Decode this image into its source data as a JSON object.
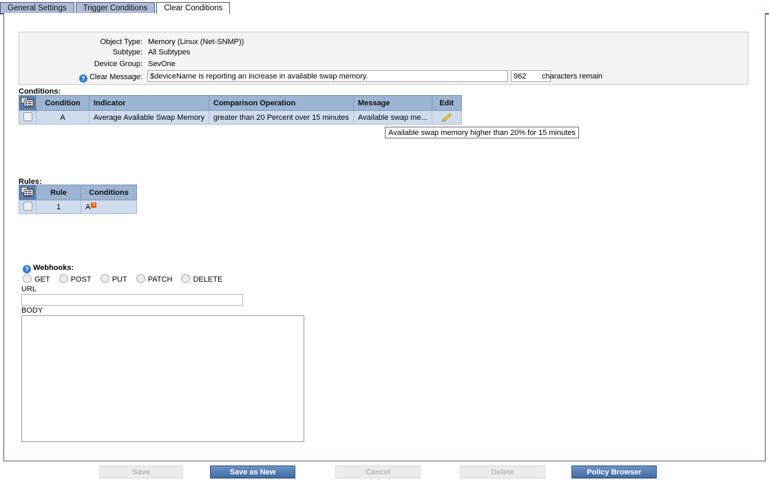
{
  "tabs": [
    {
      "label": "General Settings",
      "active": false
    },
    {
      "label": "Trigger Conditions",
      "active": false
    },
    {
      "label": "Clear Conditions",
      "active": true
    }
  ],
  "info": {
    "object_type_label": "Object Type:",
    "object_type_value": "Memory (Linux (Net-SNMP))",
    "subtype_label": "Subtype:",
    "subtype_value": "All Subtypes",
    "device_group_label": "Device Group:",
    "device_group_value": "SevOne",
    "clear_message_label": "Clear Message:",
    "clear_message_value": "$deviceName is reporting an increase in available swap memory.",
    "characters_remain_value": "962",
    "characters_remain_label": "characters remain",
    "help_icon": "help-icon"
  },
  "conditions": {
    "section_label": "Conditions:",
    "columns": [
      "",
      "Condition",
      "Indicator",
      "Comparison Operation",
      "Message",
      "Edit"
    ],
    "select_all_icon": "select-all-list-icon",
    "rows": [
      {
        "condition": "A",
        "indicator": "Average Available Swap Memory",
        "comparison": "greater than 20 Percent over 15 minutes",
        "message": "Available swap me...",
        "edit_icon": "pencil-icon"
      }
    ],
    "tooltip": "Available swap memory higher than 20% for 15 minutes"
  },
  "rules": {
    "section_label": "Rules:",
    "columns": [
      "",
      "Rule",
      "Conditions"
    ],
    "select_all_icon": "select-all-list-icon",
    "rows": [
      {
        "rule": "1",
        "conditions": "A",
        "remove_badge": "×"
      }
    ]
  },
  "webhooks": {
    "title": "Webhooks:",
    "help_icon": "help-icon",
    "methods": [
      "GET",
      "POST",
      "PUT",
      "PATCH",
      "DELETE"
    ],
    "url_label": "URL",
    "url_value": "",
    "url_placeholder": "",
    "body_label": "BODY",
    "body_value": "",
    "body_placeholder": ""
  },
  "footer": {
    "buttons": [
      {
        "label": "Save",
        "style": "disabled"
      },
      {
        "label": "Save as New",
        "style": "primary"
      },
      {
        "label": "Cancel",
        "style": "disabled"
      },
      {
        "label": "Delete",
        "style": "disabled"
      },
      {
        "label": "Policy Browser",
        "style": "primary"
      }
    ]
  },
  "colors": {
    "tab_inactive": "#aebdd6",
    "tab_border": "#4a5a7a",
    "table_header": "#9bb4d4",
    "table_header_checkbox": "#5c7fae",
    "table_row": "#cfdced",
    "primary_button": "#3f6ba6",
    "badge_orange": "#f0680b",
    "help_blue": "#2a7fd4"
  }
}
